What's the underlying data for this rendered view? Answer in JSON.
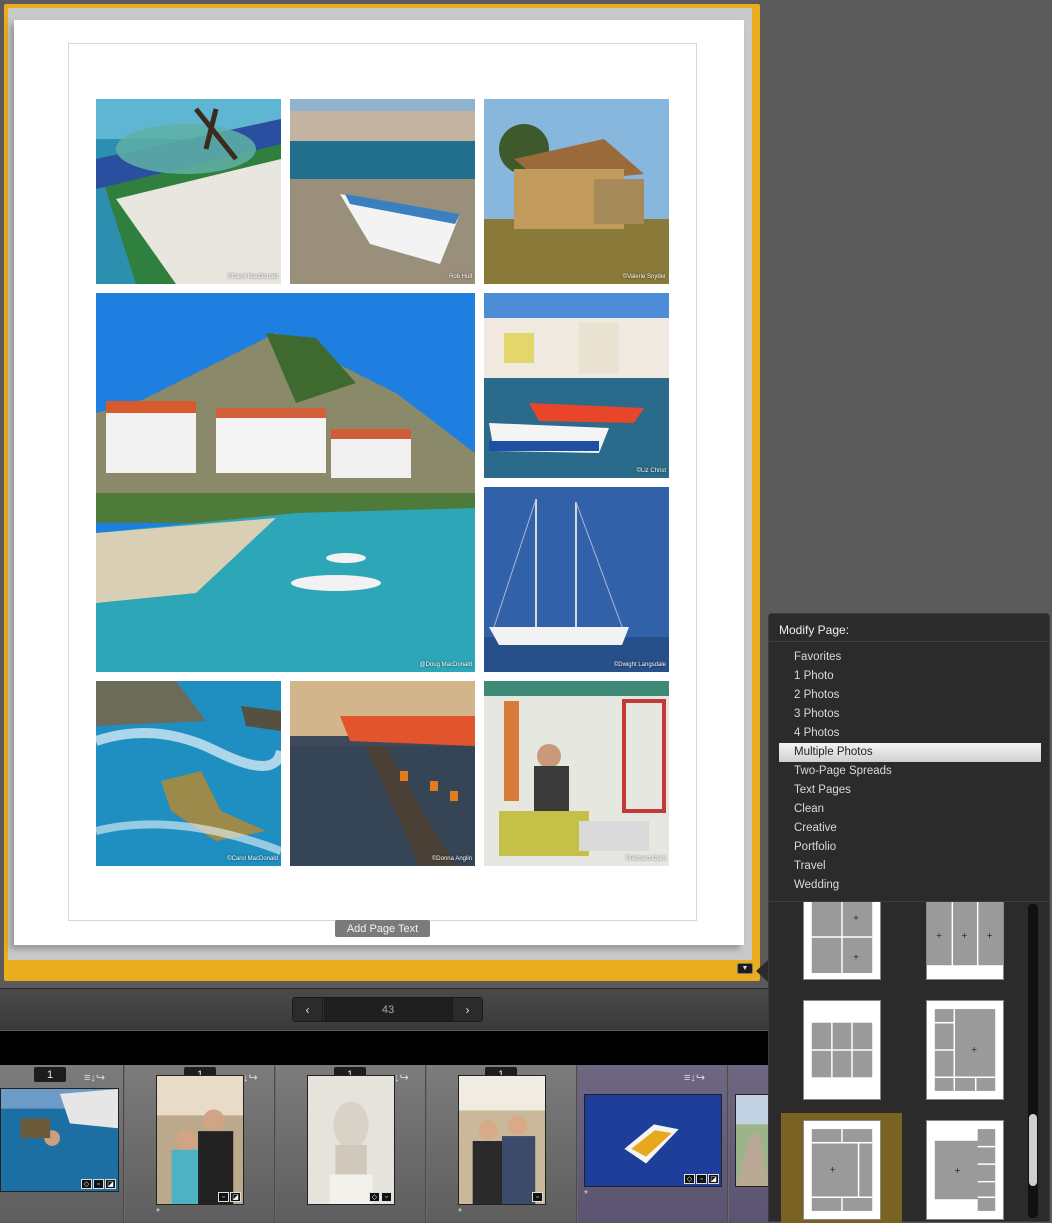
{
  "page": {
    "photos": [
      {
        "credit": "©Carol MacDonald",
        "icon": "boat-rope-photo"
      },
      {
        "credit": "Rob Hull",
        "icon": "beached-boat-photo"
      },
      {
        "credit": "©Valerie Snyder",
        "icon": "stone-house-photo"
      },
      {
        "credit": "@Doug MacDonald",
        "icon": "harbor-village-photo"
      },
      {
        "credit": "©Liz Christ",
        "icon": "harbor-boats-photo"
      },
      {
        "credit": "©Dwight Langsdale",
        "icon": "sailing-yacht-photo"
      },
      {
        "credit": "©Carol MacDonald",
        "icon": "coastal-rock-photo"
      },
      {
        "credit": "©Donna Anglin",
        "icon": "pier-posts-photo"
      },
      {
        "credit": "©Richard Clark",
        "icon": "fisherman-photo"
      }
    ],
    "add_text_label": "Add Page Text"
  },
  "nav": {
    "prev": "‹",
    "page_number": "43",
    "next": "›"
  },
  "filmstrip": {
    "items": [
      {
        "badge": "1",
        "star": ""
      },
      {
        "badge": "1",
        "star": "*"
      },
      {
        "badge": "1",
        "star": ""
      },
      {
        "badge": "1",
        "star": "*"
      },
      {
        "badge": "",
        "star": "*"
      }
    ]
  },
  "modify_page": {
    "title": "Modify Page:",
    "categories": [
      "Favorites",
      "1 Photo",
      "2 Photos",
      "3 Photos",
      "4 Photos",
      "Multiple Photos",
      "Two-Page Spreads",
      "Text Pages",
      "Clean",
      "Creative",
      "Portfolio",
      "Travel",
      "Wedding"
    ],
    "selected_category": "Multiple Photos",
    "layout_plus": "+"
  },
  "colors": {
    "frame_accent": "#e9ad1e",
    "selected_layout": "#7a6222"
  }
}
